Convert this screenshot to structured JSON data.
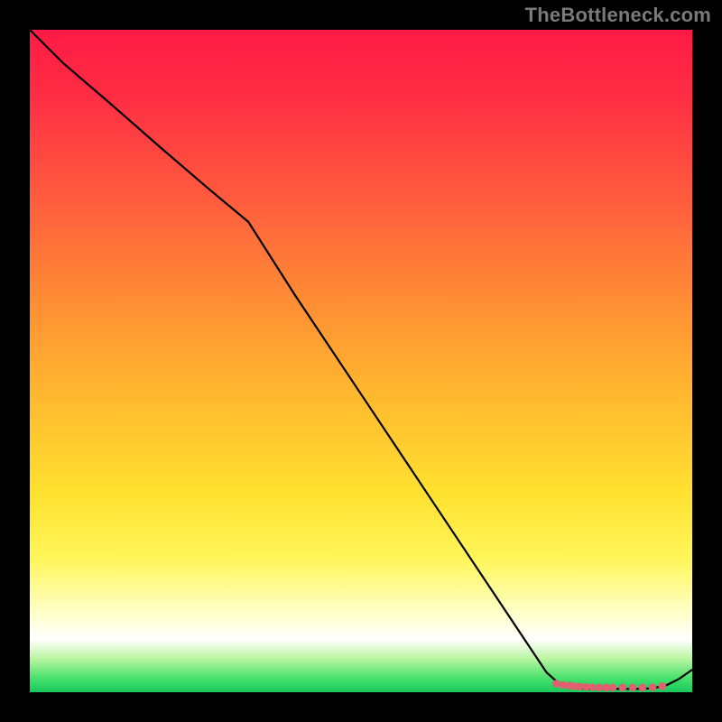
{
  "attribution": "TheBottleneck.com",
  "chart_data": {
    "type": "line",
    "title": "",
    "xlabel": "",
    "ylabel": "",
    "xlim": [
      0,
      100
    ],
    "ylim": [
      0,
      100
    ],
    "series": [
      {
        "name": "curve",
        "x": [
          0,
          5,
          12,
          20,
          27,
          33,
          40,
          50,
          60,
          70,
          78,
          80,
          82,
          84,
          86,
          88,
          90,
          92,
          94,
          96,
          98,
          100
        ],
        "y": [
          100,
          95,
          89,
          82,
          76,
          71,
          60,
          45,
          30,
          15,
          3,
          1.2,
          0.7,
          0.5,
          0.5,
          0.5,
          0.5,
          0.5,
          0.6,
          1.0,
          2.0,
          3.4
        ]
      }
    ],
    "markers": [
      {
        "x": 79.5,
        "y": 1.3
      },
      {
        "x": 80.5,
        "y": 1.1
      },
      {
        "x": 81.5,
        "y": 1.0
      },
      {
        "x": 82.2,
        "y": 0.9
      },
      {
        "x": 83.0,
        "y": 0.85
      },
      {
        "x": 84.0,
        "y": 0.8
      },
      {
        "x": 85.0,
        "y": 0.75
      },
      {
        "x": 86.0,
        "y": 0.7
      },
      {
        "x": 87.0,
        "y": 0.7
      },
      {
        "x": 88.0,
        "y": 0.7
      },
      {
        "x": 89.5,
        "y": 0.7
      },
      {
        "x": 91.0,
        "y": 0.7
      },
      {
        "x": 92.5,
        "y": 0.7
      },
      {
        "x": 94.0,
        "y": 0.75
      },
      {
        "x": 95.5,
        "y": 0.9
      }
    ],
    "marker_color": "#e06070",
    "line_color": "#000000"
  }
}
